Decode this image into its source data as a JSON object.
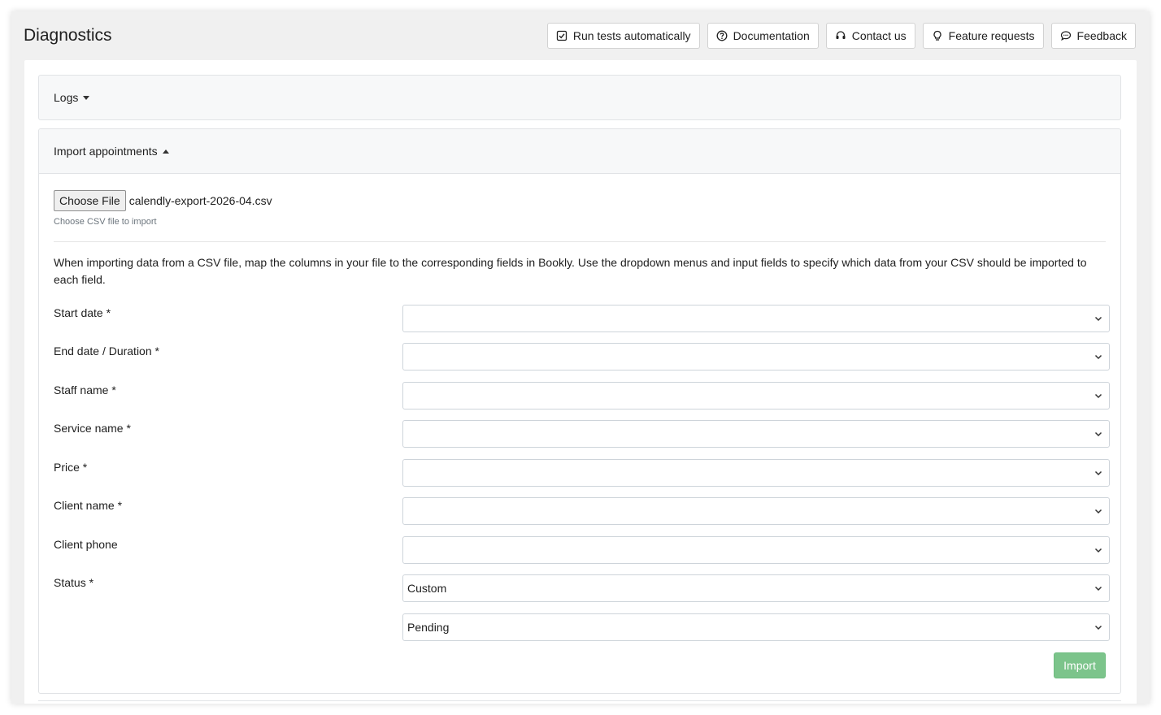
{
  "header": {
    "title": "Diagnostics",
    "buttons": {
      "run_tests": "Run tests automatically",
      "documentation": "Documentation",
      "contact": "Contact us",
      "feature_requests": "Feature requests",
      "feedback": "Feedback"
    }
  },
  "panels": {
    "logs": "Logs",
    "import": "Import appointments"
  },
  "import": {
    "choose_file_label": "Choose File",
    "file_name": "calendly-export-2026-04.csv",
    "file_help": "Choose CSV file to import",
    "description": "When importing data from a CSV file, map the columns in your file to the corresponding fields in Bookly. Use the dropdown menus and input fields to specify which data from your CSV should be imported to each field.",
    "fields": [
      {
        "label": "Start date *",
        "value": ""
      },
      {
        "label": "End date / Duration *",
        "value": ""
      },
      {
        "label": "Staff name *",
        "value": ""
      },
      {
        "label": "Service name *",
        "value": ""
      },
      {
        "label": "Price *",
        "value": ""
      },
      {
        "label": "Client name *",
        "value": ""
      },
      {
        "label": "Client phone",
        "value": ""
      },
      {
        "label": "Status *",
        "value": "Custom"
      }
    ],
    "status_custom_value": "Pending",
    "import_button": "Import"
  },
  "colors": {
    "import_button": "#7cc48b",
    "panel_header_bg": "#f7f8f9",
    "page_bg": "#f0f0f0"
  },
  "icons": {
    "run_tests": "checkbox-icon",
    "documentation": "question-circle-icon",
    "contact": "headset-icon",
    "feature_requests": "lightbulb-icon",
    "feedback": "chat-bubble-icon",
    "select": "chevron-down-icon"
  }
}
